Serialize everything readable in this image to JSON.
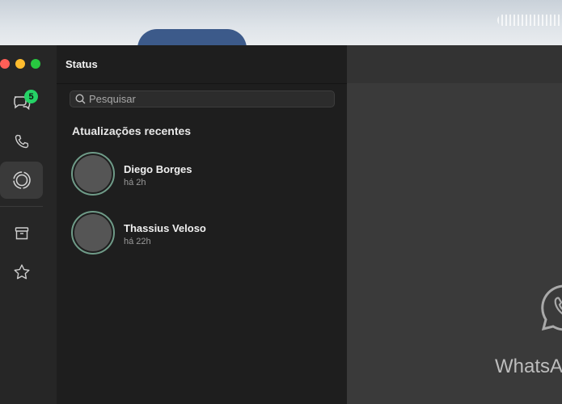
{
  "window": {
    "title": "Status"
  },
  "rail": {
    "chats_badge": "5",
    "items": [
      {
        "id": "chats",
        "icon": "chat-bubbles-icon"
      },
      {
        "id": "calls",
        "icon": "phone-icon"
      },
      {
        "id": "status",
        "icon": "status-ring-icon",
        "active": true
      },
      {
        "id": "archived",
        "icon": "archive-box-icon"
      },
      {
        "id": "starred",
        "icon": "star-icon"
      }
    ]
  },
  "search": {
    "placeholder": "Pesquisar",
    "value": ""
  },
  "section": {
    "title": "Atualizações recentes"
  },
  "statuses": [
    {
      "name": "Diego Borges",
      "time": "há 2h"
    },
    {
      "name": "Thassius Veloso",
      "time": "há 22h"
    }
  ],
  "main": {
    "brand": "WhatsApp"
  },
  "colors": {
    "accent": "#25d366",
    "ring": "#6f9b88",
    "background": "#1e1e1e",
    "rail": "#262626",
    "main": "#3a3a3a"
  }
}
